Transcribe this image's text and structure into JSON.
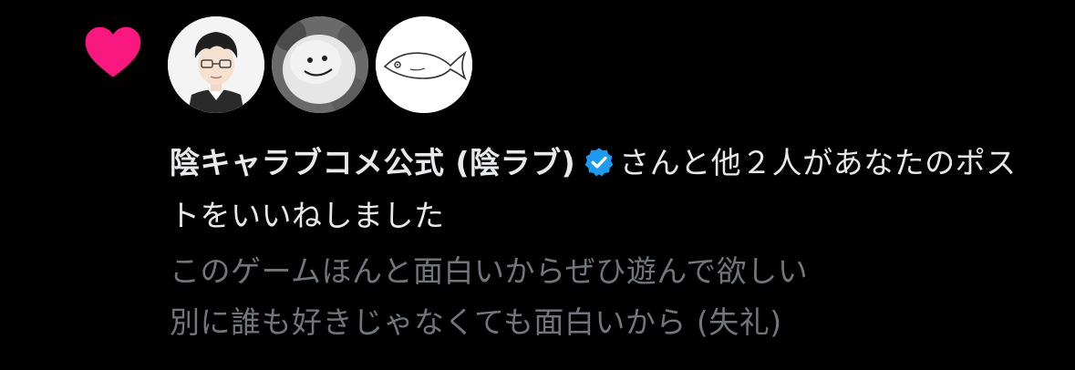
{
  "notification": {
    "type_icon": "heart-icon",
    "accent_color": "#f91880",
    "verified_color": "#1d9bf0",
    "avatars": [
      {
        "icon": "anime-boy-avatar"
      },
      {
        "icon": "snowman-photo-avatar"
      },
      {
        "icon": "fish-drawing-avatar"
      }
    ],
    "user_name": "陰キャラブコメ公式 (陰ラブ)",
    "action_text": "さんと他２人があなたのポストをいいねしました",
    "post_preview": {
      "line1": "このゲームほんと面白いからぜひ遊んで欲しい",
      "line2": "別に誰も好きじゃなくても面白いから (失礼)"
    }
  }
}
